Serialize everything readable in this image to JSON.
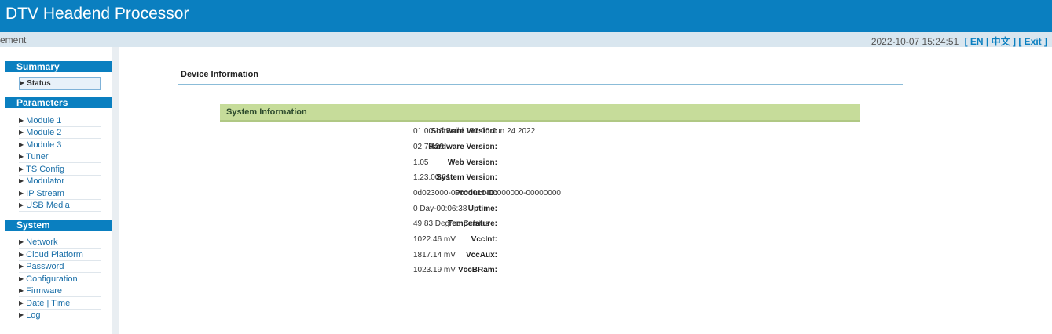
{
  "header": {
    "title": "DTV Headend Processor"
  },
  "subbar": {
    "left_text": "ement",
    "datetime": "2022-10-07 15:24:51",
    "lang_en": "[ EN |",
    "lang_zh": "中文 ]",
    "exit": "[ Exit ]"
  },
  "sidebar": {
    "summary": {
      "title": "Summary",
      "items": [
        {
          "label": "Status"
        }
      ]
    },
    "parameters": {
      "title": "Parameters",
      "items": [
        {
          "label": "Module 1"
        },
        {
          "label": "Module 2"
        },
        {
          "label": "Module 3"
        },
        {
          "label": "Tuner"
        },
        {
          "label": "TS Config"
        },
        {
          "label": "Modulator"
        },
        {
          "label": "IP Stream"
        },
        {
          "label": "USB Media"
        }
      ]
    },
    "system": {
      "title": "System",
      "items": [
        {
          "label": "Network"
        },
        {
          "label": "Cloud Platform"
        },
        {
          "label": "Password"
        },
        {
          "label": "Configuration"
        },
        {
          "label": "Firmware"
        },
        {
          "label": "Date | Time"
        },
        {
          "label": "Log"
        }
      ]
    }
  },
  "main": {
    "page_title": "Device Information",
    "panel_title": "System Information",
    "rows": [
      {
        "label": "Software Version:",
        "value": "01.00.13 Build 160.00 Jun 24 2022"
      },
      {
        "label": "Hardware Version:",
        "value": "02.70.29"
      },
      {
        "label": "Web Version:",
        "value": "1.05"
      },
      {
        "label": "System Version:",
        "value": "1.23.00.01"
      },
      {
        "label": "Product ID:",
        "value": "0d023000-00000010-00000000-00000000"
      },
      {
        "label": "Uptime:",
        "value": "0 Day-00:06:38"
      },
      {
        "label": "Temperature:",
        "value": "49.83 Degree Celsius"
      },
      {
        "label": "VccInt:",
        "value": "1022.46 mV"
      },
      {
        "label": "VccAux:",
        "value": "1817.14 mV"
      },
      {
        "label": "VccBRam:",
        "value": "1023.19 mV"
      }
    ]
  },
  "colors": {
    "brand": "#0a7fc0",
    "panel": "#c6dc9a",
    "link": "#1a6fa8"
  }
}
